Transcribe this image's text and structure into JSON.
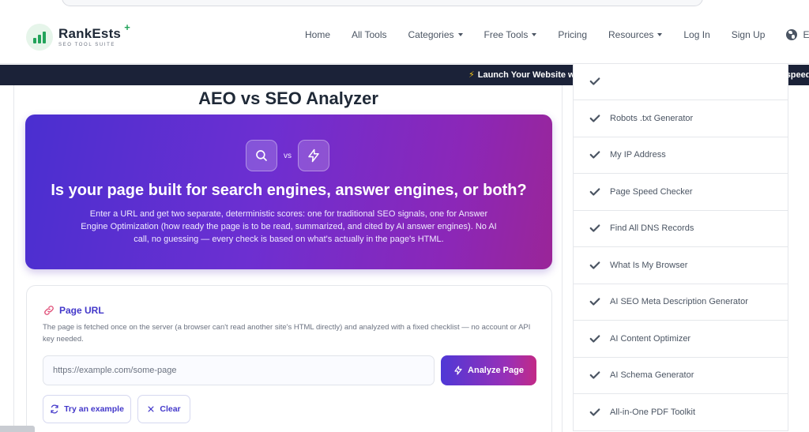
{
  "logo": {
    "name": "RankEsts",
    "plus": "+",
    "tagline": "SEO TOOL SUITE"
  },
  "nav": {
    "items": [
      {
        "label": "Home",
        "caret": false
      },
      {
        "label": "All Tools",
        "caret": false
      },
      {
        "label": "Categories",
        "caret": true
      },
      {
        "label": "Free Tools",
        "caret": true
      },
      {
        "label": "Pricing",
        "caret": false
      },
      {
        "label": "Resources",
        "caret": true
      },
      {
        "label": "Log In",
        "caret": false
      },
      {
        "label": "Sign Up",
        "caret": false
      }
    ],
    "language": "EN"
  },
  "ticker": {
    "text": "Launch Your Website with Lightning-Fast Hosting! Experience unmatched speed and"
  },
  "page": {
    "title": "AEO vs SEO Analyzer",
    "vs": "vs",
    "headline": "Is your page built for search engines, answer engines, or both?",
    "description": "Enter a URL and get two separate, deterministic scores: one for traditional SEO signals, one for Answer Engine Optimization (how ready the page is to be read, summarized, and cited by AI answer engines). No AI call, no guessing — every check is based on what's actually in the page's HTML."
  },
  "form": {
    "label": "Page URL",
    "help": "The page is fetched once on the server (a browser can't read another site's HTML directly) and analyzed with a fixed checklist — no account or API key needed.",
    "placeholder": "https://example.com/some-page",
    "value": "",
    "analyze_label": "Analyze Page",
    "try_label": "Try an example",
    "clear_label": "Clear"
  },
  "sidebar": {
    "items": [
      {
        "label": ""
      },
      {
        "label": "Robots .txt Generator"
      },
      {
        "label": "My IP Address"
      },
      {
        "label": "Page Speed Checker"
      },
      {
        "label": "Find All DNS Records"
      },
      {
        "label": "What Is My Browser"
      },
      {
        "label": "AI SEO Meta Description Generator"
      },
      {
        "label": "AI Content Optimizer"
      },
      {
        "label": "AI Schema Generator"
      },
      {
        "label": "All-in-One PDF Toolkit"
      }
    ]
  },
  "icons": {
    "logo": "bar-chart-icon",
    "search": "search-icon",
    "bolt": "lightning-bolt-icon",
    "link": "link-icon",
    "refresh": "refresh-icon",
    "close": "close-icon",
    "check": "checkmark-icon",
    "globe": "globe-icon"
  },
  "colors": {
    "brand_green": "#22a35a",
    "accent_indigo": "#4338ca",
    "ticker_bg": "#1b2238",
    "hero_start": "#4a2fd0",
    "hero_end": "#9a2598"
  }
}
